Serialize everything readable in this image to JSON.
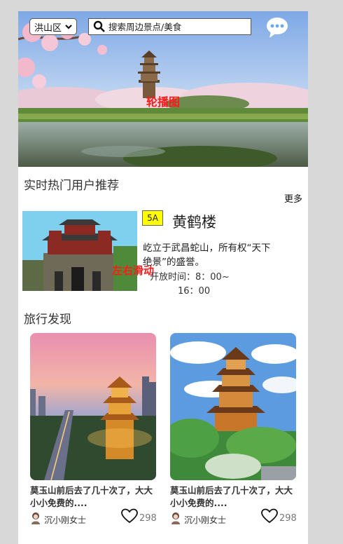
{
  "header": {
    "district": "洪山区",
    "search_placeholder": "搜索周边景点/美食",
    "banner_caption": "轮播图"
  },
  "recommend": {
    "title": "实时热门用户推荐",
    "more": "更多",
    "overlay": "左右滑动",
    "spot": {
      "grade": "5A",
      "name": "黄鹤楼",
      "description": "屹立于武昌蛇山，所有权“天下绝景”的盛誉。",
      "hours_line1": "开放时间：8：00~",
      "hours_line2": "16：00"
    }
  },
  "discover": {
    "title": "旅行发现",
    "cards": [
      {
        "title": "莫玉山前后去了几十次了，大大小小免费的....",
        "author": "沉小刚女士",
        "likes": "298"
      },
      {
        "title": "莫玉山前后去了几十次了，大大小小免费的....",
        "author": "沉小刚女士",
        "likes": "298"
      }
    ]
  },
  "icons": {
    "search": "magnifier-icon",
    "dropdown": "chevron-down-icon",
    "chat": "chat-bubble-icon",
    "like": "heart-icon",
    "avatar": "user-avatar-icon"
  },
  "colors": {
    "caption_red": "#ff1a1a",
    "grade_bg": "#ffff00",
    "chat_blue": "#6aa9f4"
  }
}
